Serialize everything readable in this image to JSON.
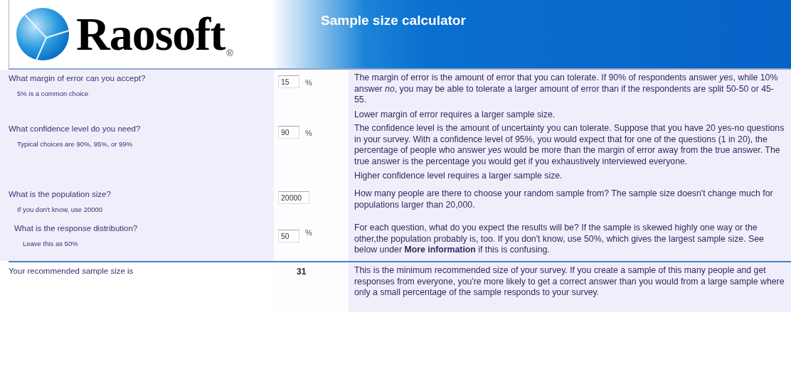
{
  "header": {
    "logo_text": "Raosoft",
    "registered_mark": "®",
    "title": "Sample size calculator"
  },
  "questions": [
    {
      "question": "What margin of error can you accept?",
      "hint": "5% is a common choice",
      "value": "15",
      "unit": "%",
      "paragraphs": [
        "The margin of error is the amount of error that you can tolerate. If 90% of respondents answer *yes*, while 10% answer *no*, you may be able to tolerate a larger amount of error than if the respondents are split 50-50 or 45-55.",
        "Lower margin of error requires a larger sample size."
      ]
    },
    {
      "question": "What confidence level do you need?",
      "hint": "Typical choices are 90%, 95%, or 99%",
      "value": "90",
      "unit": "%",
      "paragraphs": [
        "The confidence level is the amount of uncertainty you can tolerate. Suppose that you have 20 yes-no questions in your survey. With a confidence level of 95%, you would expect that for one of the questions (1 in 20), the percentage of people who answer *yes* would be more than the margin of error away from the true answer. The true answer is the percentage you would get if you exhaustively interviewed everyone.",
        "Higher confidence level requires a larger sample size."
      ]
    },
    {
      "question": "What is the population size?",
      "hint": "If you don't know, use 20000",
      "value": "20000",
      "paragraphs": [
        "How many people are there to choose your random sample from? The sample size doesn't change much for populations larger than 20,000."
      ]
    },
    {
      "question": "What is the response distribution?",
      "hint": "Leave this as 50%",
      "value": "50",
      "unit": "%",
      "paragraphs": [
        "For each question, what do you expect the results will be? If the sample is skewed highly one way or the other,the population probably is, too. If you don't know, use 50%, which gives the largest sample size. See below under **More information** if this is confusing."
      ]
    }
  ],
  "result": {
    "label": "Your recommended sample size is",
    "value": "31",
    "description": "This is the minimum recommended size of your survey. If you create a sample of this many people and get responses from everyone, you're more likely to get a correct answer than you would from a large sample where only a small percentage of the sample responds to your survey."
  }
}
